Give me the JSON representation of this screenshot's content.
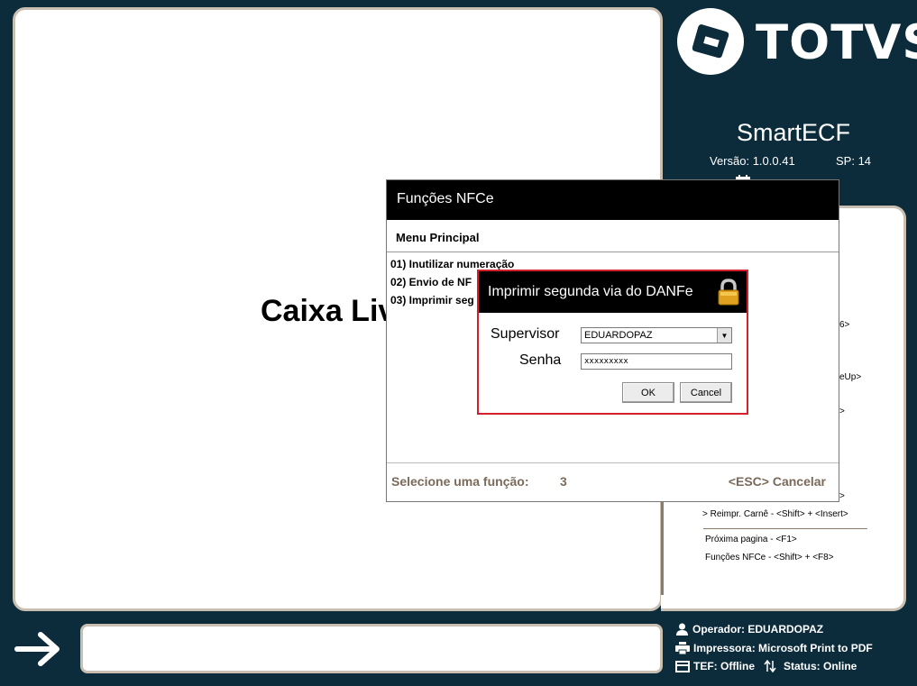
{
  "main": {
    "caixa_text": "Caixa Liv"
  },
  "brand": {
    "logo_text": "TOTVS",
    "app_name": "SmartECF",
    "version": "Versão: 1.0.0.41",
    "sp": "SP: 14"
  },
  "shortcuts": {
    "fragments": [
      "6>",
      "eUp>",
      ">",
      ">"
    ],
    "reimpr_carne": "> Reimpr. Carnê - <Shift> + <Insert>",
    "proxima_pagina": "Próxima pagina - <F1>",
    "funcoes_nfce": "Funções NFCe - <Shift> + <F8>"
  },
  "nfce_window": {
    "title": "Funções NFCe",
    "menu_header": "Menu Principal",
    "options": [
      "01) Inutilizar numeração",
      "02) Envio de NF",
      "03) Imprimir seg"
    ],
    "select_label": "Selecione uma função:",
    "select_value": "3",
    "cancel_label": "<ESC> Cancelar"
  },
  "supervisor_dialog": {
    "title": "Imprimir segunda via do DANFe",
    "supervisor_label": "Supervisor",
    "supervisor_value": "EDUARDOPAZ",
    "password_label": "Senha",
    "password_value": "xxxxxxxxx",
    "ok_label": "OK",
    "cancel_label": "Cancel"
  },
  "status": {
    "operator": "Operador: EDUARDOPAZ",
    "printer": "Impressora: Microsoft Print to PDF",
    "tef": "TEF: Offline",
    "status": "Status:  Online"
  },
  "colors": {
    "background": "#0c2c3c",
    "panel_border": "#c9bfb0",
    "dialog_border": "#d4202a",
    "muted_text": "#7a6a5a"
  }
}
